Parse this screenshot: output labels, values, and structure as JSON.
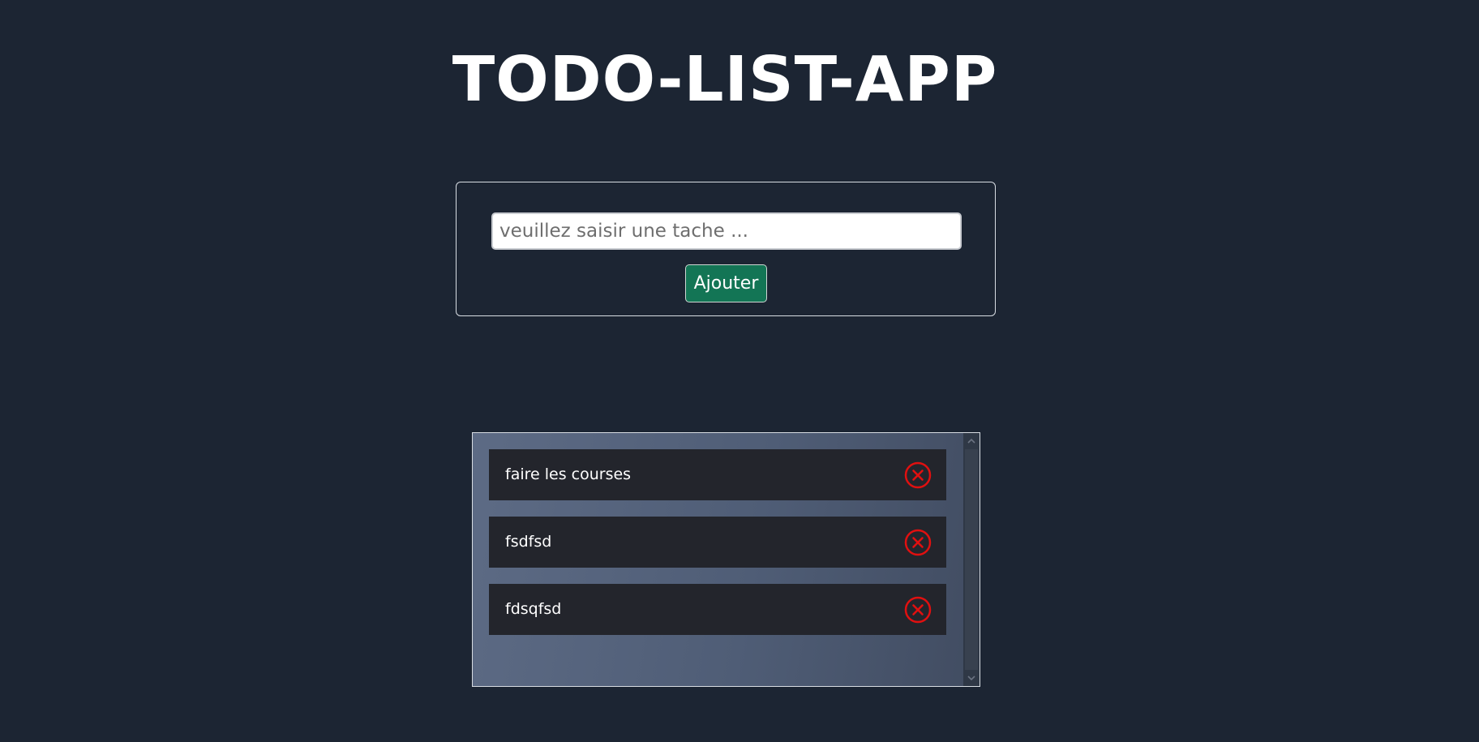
{
  "header": {
    "title": "TODO-LIST-APP"
  },
  "form": {
    "input_value": "",
    "input_placeholder": "veuillez saisir une tache ...",
    "add_label": "Ajouter"
  },
  "todos": [
    {
      "text": "faire les courses",
      "delete_icon": "close-circle-icon"
    },
    {
      "text": "fsdfsd",
      "delete_icon": "close-circle-icon"
    },
    {
      "text": "fdsqfsd",
      "delete_icon": "close-circle-icon"
    }
  ],
  "colors": {
    "background": "#1c2533",
    "button_green": "#137555",
    "item_background": "#23252c",
    "delete_red": "#e01010",
    "text": "#ffffff"
  }
}
